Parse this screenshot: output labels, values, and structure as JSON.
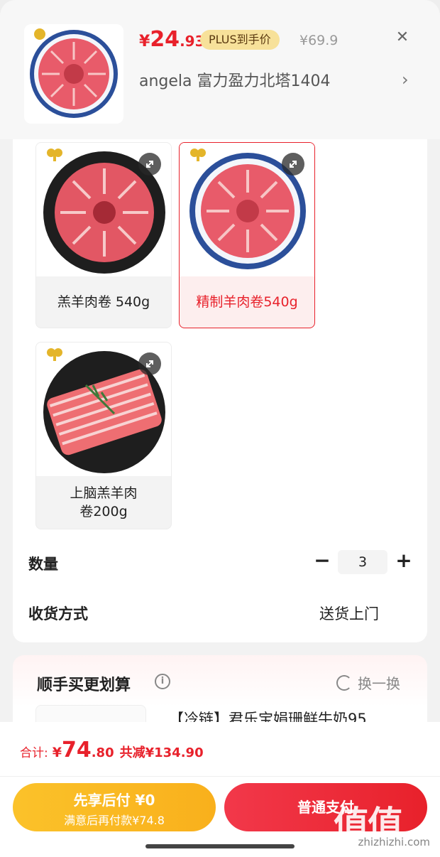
{
  "header": {
    "price_currency": "¥",
    "price_int": "24",
    "price_dec": ".93",
    "plus_tag": "PLUS到手价",
    "original_price": "¥69.9",
    "close_icon": "close-icon",
    "address": "angela  富力盈力北塔1404",
    "address_arrow": "›"
  },
  "options": [
    {
      "label": "羔羊肉卷 540g",
      "selected": false
    },
    {
      "label": "精制羊肉卷540g",
      "selected": true
    },
    {
      "label": "上脑羔羊肉卷200g",
      "selected": false
    }
  ],
  "quantity": {
    "label": "数量",
    "minus": "−",
    "value": "3",
    "plus": "+"
  },
  "delivery": {
    "label": "收货方式",
    "value": "送货上门"
  },
  "recommend": {
    "title": "顺手买更划算",
    "info_glyph": "i",
    "swap_label": "换一换",
    "item_name": "【冷链】君乐宝娟珊鲜牛奶95"
  },
  "footer": {
    "total_label": "合计:",
    "total_currency": "¥",
    "total_int": "74",
    "total_dec": ".80",
    "saved": "共减¥134.90",
    "pay_later_title": "先享后付 ¥0",
    "pay_later_sub": "满意后再付款¥74.8",
    "normal_pay": "普通支付"
  },
  "watermark": {
    "big": "值值值",
    "small": "zhizhizhi.com"
  },
  "colors": {
    "accent": "#e8212b",
    "gold": "#fbc22a",
    "plus_tag_bg": "#f7e19a"
  }
}
